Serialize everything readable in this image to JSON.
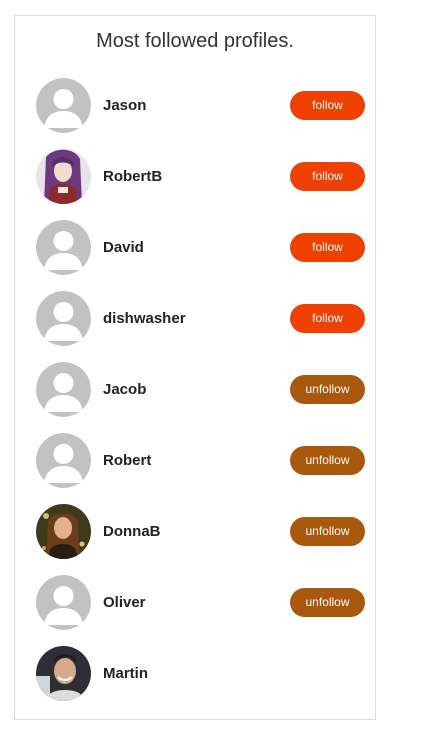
{
  "panel": {
    "title": "Most followed profiles."
  },
  "colors": {
    "follow": "#ef4000",
    "unfollow": "#a8590e",
    "placeholder_avatar": "#c2c2c2"
  },
  "profiles": [
    {
      "name": "Jason",
      "avatar": "default-avatar-icon",
      "action": "follow"
    },
    {
      "name": "RobertB",
      "avatar": "anime-character-photo",
      "action": "follow"
    },
    {
      "name": "David",
      "avatar": "default-avatar-icon",
      "action": "follow"
    },
    {
      "name": "dishwasher",
      "avatar": "default-avatar-icon",
      "action": "follow"
    },
    {
      "name": "Jacob",
      "avatar": "default-avatar-icon",
      "action": "unfollow"
    },
    {
      "name": "Robert",
      "avatar": "default-avatar-icon",
      "action": "unfollow"
    },
    {
      "name": "DonnaB",
      "avatar": "woman-photo",
      "action": "unfollow"
    },
    {
      "name": "Oliver",
      "avatar": "default-avatar-icon",
      "action": "unfollow"
    },
    {
      "name": "Martin",
      "avatar": "man-photo",
      "action": ""
    }
  ]
}
